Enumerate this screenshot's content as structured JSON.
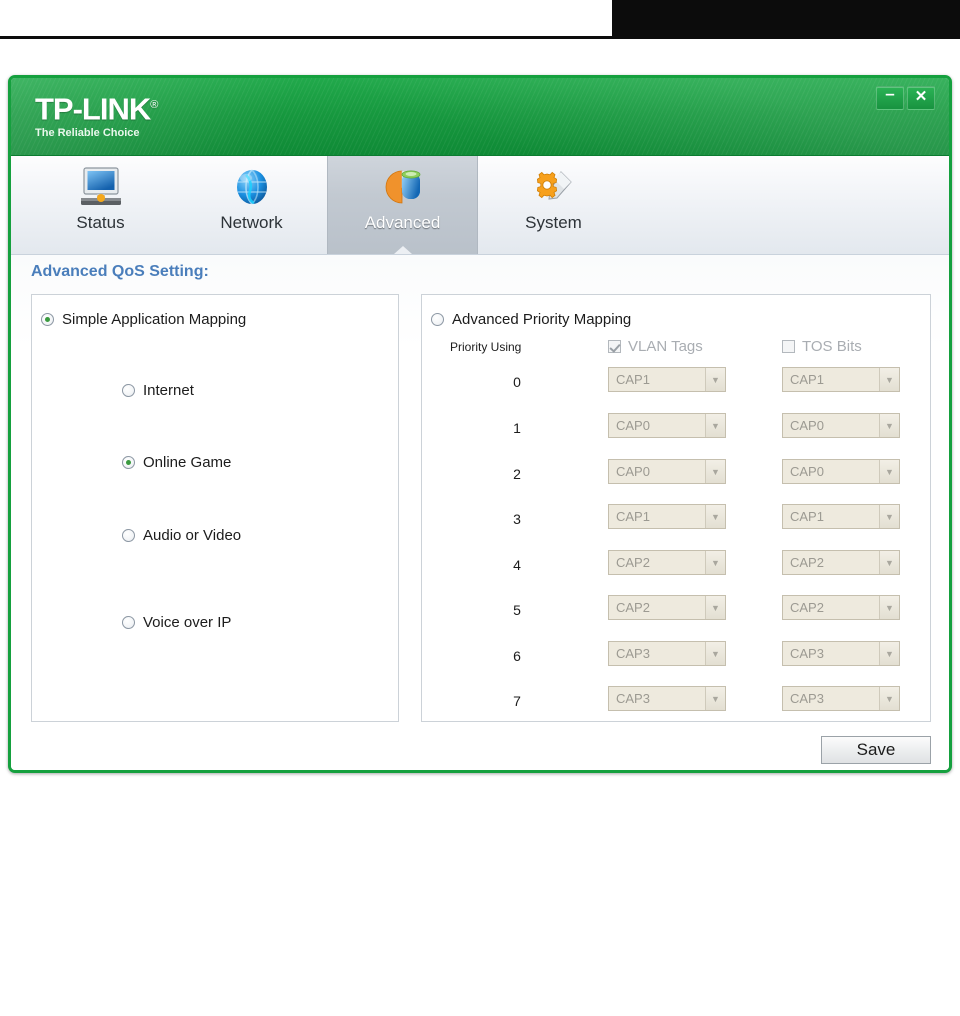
{
  "window": {
    "brand_name": "TP-LINK",
    "brand_tm": "®",
    "brand_tagline": "The Reliable Choice",
    "minimize_label": "–",
    "close_label": "✕",
    "accent_green": "#15a03e",
    "title_color": "#4a7ebb"
  },
  "tabs": [
    {
      "label": "Status",
      "icon": "monitor-icon",
      "active": false
    },
    {
      "label": "Network",
      "icon": "globe-icon",
      "active": false
    },
    {
      "label": "Advanced",
      "icon": "chart-pie-icon",
      "active": true
    },
    {
      "label": "System",
      "icon": "gear-wrench-icon",
      "active": false
    }
  ],
  "content": {
    "section_title": "Advanced QoS Setting:"
  },
  "simple_panel": {
    "root_option": {
      "label": "Simple Application Mapping",
      "selected": true
    },
    "options": [
      {
        "label": "Internet",
        "selected": false
      },
      {
        "label": "Online Game",
        "selected": true
      },
      {
        "label": "Audio or Video",
        "selected": false
      },
      {
        "label": "Voice over IP",
        "selected": false
      }
    ]
  },
  "advanced_panel": {
    "root_option": {
      "label": "Advanced Priority Mapping",
      "selected": false
    },
    "priority_using_label": "Priority Using",
    "columns": [
      {
        "label": "VLAN Tags",
        "checked": true,
        "disabled": true
      },
      {
        "label": "TOS Bits",
        "checked": false,
        "disabled": true
      }
    ],
    "rows": [
      {
        "priority": "0",
        "vlan": "CAP1",
        "tos": "CAP1"
      },
      {
        "priority": "1",
        "vlan": "CAP0",
        "tos": "CAP0"
      },
      {
        "priority": "2",
        "vlan": "CAP0",
        "tos": "CAP0"
      },
      {
        "priority": "3",
        "vlan": "CAP1",
        "tos": "CAP1"
      },
      {
        "priority": "4",
        "vlan": "CAP2",
        "tos": "CAP2"
      },
      {
        "priority": "5",
        "vlan": "CAP2",
        "tos": "CAP2"
      },
      {
        "priority": "6",
        "vlan": "CAP3",
        "tos": "CAP3"
      },
      {
        "priority": "7",
        "vlan": "CAP3",
        "tos": "CAP3"
      }
    ],
    "dropdown_options": [
      "CAP0",
      "CAP1",
      "CAP2",
      "CAP3"
    ],
    "dropdown_arrow": "▼"
  },
  "actions": {
    "save_label": "Save"
  }
}
